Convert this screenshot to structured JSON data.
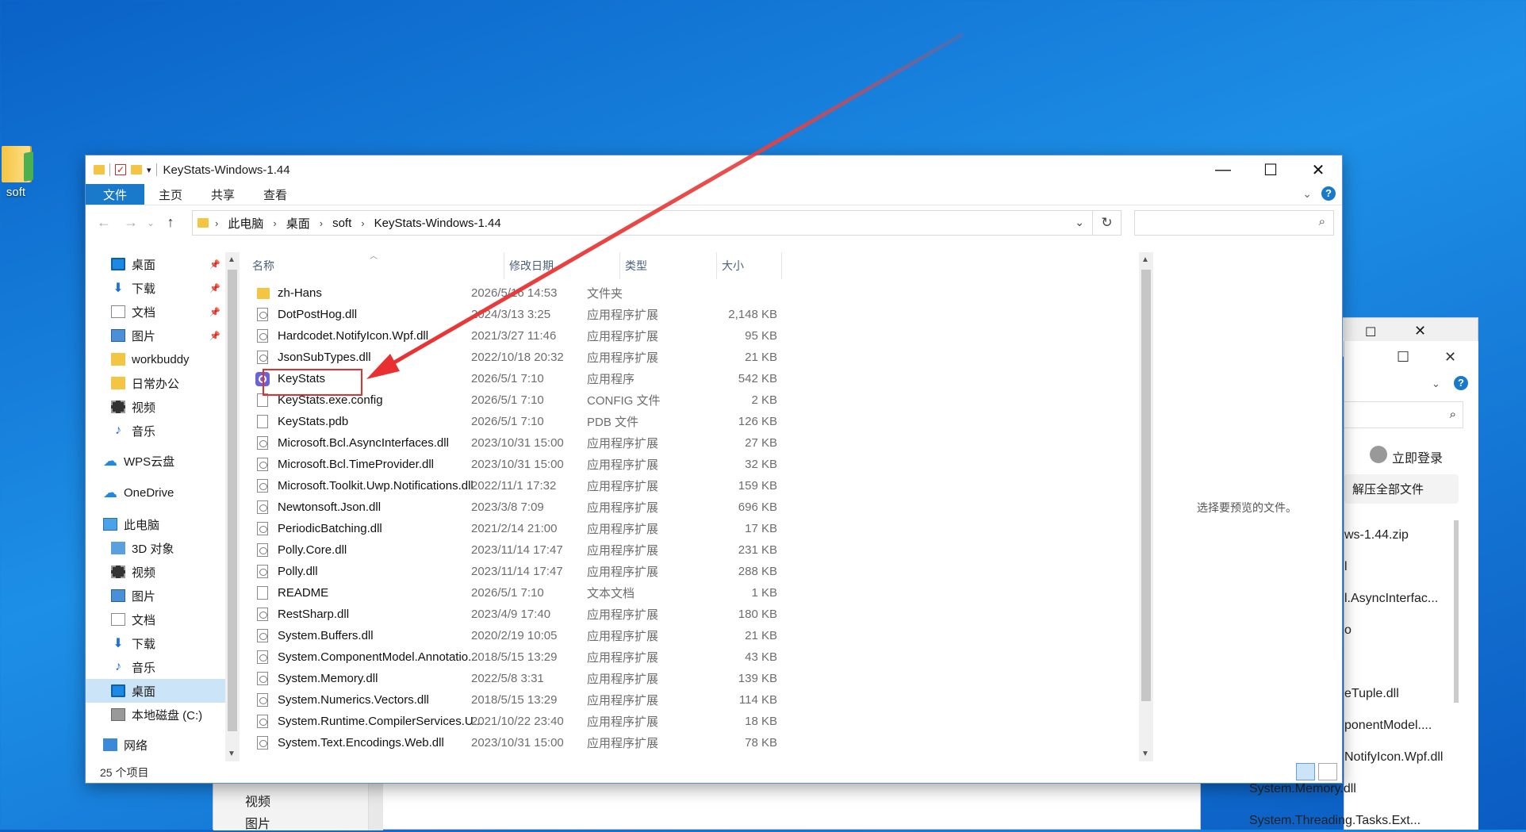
{
  "desktop": {
    "icon_label": "soft",
    "bg_window": {
      "items": [
        "立即登录",
        "解压全部文件",
        "ws-1.44.zip",
        "l",
        "l.AsyncInterfac...",
        "o",
        "eTuple.dll",
        "ponentModel....",
        "NotifyIcon.Wpf.dll",
        "System.Memory.dll",
        "System.Threading.Tasks.Ext..."
      ],
      "nav_items": [
        "视频",
        "图片"
      ]
    }
  },
  "window": {
    "title": "KeyStats-Windows-1.44",
    "controls": {
      "minimize": "—",
      "maximize": "☐",
      "close": "✕"
    },
    "ribbon": {
      "file": "文件",
      "home": "主页",
      "share": "共享",
      "view": "查看"
    },
    "address": {
      "crumbs": [
        "此电脑",
        "桌面",
        "soft",
        "KeyStats-Windows-1.44"
      ]
    },
    "search_placeholder": "",
    "nav": [
      {
        "label": "桌面",
        "icon": "desktop-icon",
        "pinned": true
      },
      {
        "label": "下载",
        "icon": "download-icon",
        "pinned": true
      },
      {
        "label": "文档",
        "icon": "document-icon",
        "pinned": true
      },
      {
        "label": "图片",
        "icon": "picture-icon",
        "pinned": true
      },
      {
        "label": "workbuddy",
        "icon": "folder-icon",
        "pinned": false
      },
      {
        "label": "日常办公",
        "icon": "folder-icon",
        "pinned": false
      },
      {
        "label": "视频",
        "icon": "video-icon",
        "pinned": false
      },
      {
        "label": "音乐",
        "icon": "music-icon",
        "pinned": false
      },
      {
        "label": "WPS云盘",
        "icon": "cloud-icon",
        "pinned": false
      },
      {
        "label": "OneDrive",
        "icon": "cloud-icon",
        "pinned": false
      },
      {
        "label": "此电脑",
        "icon": "pc-icon",
        "pinned": false
      },
      {
        "label": "3D 对象",
        "icon": "3d-icon",
        "pinned": false
      },
      {
        "label": "视频",
        "icon": "video-icon",
        "pinned": false
      },
      {
        "label": "图片",
        "icon": "picture-icon",
        "pinned": false
      },
      {
        "label": "文档",
        "icon": "document-icon",
        "pinned": false
      },
      {
        "label": "下载",
        "icon": "download-icon",
        "pinned": false
      },
      {
        "label": "音乐",
        "icon": "music-icon",
        "pinned": false
      },
      {
        "label": "桌面",
        "icon": "desktop-icon",
        "pinned": false,
        "selected": true
      },
      {
        "label": "本地磁盘 (C:)",
        "icon": "disk-icon",
        "pinned": false
      },
      {
        "label": "网络",
        "icon": "network-icon",
        "pinned": false
      }
    ],
    "columns": {
      "name": "名称",
      "date": "修改日期",
      "type": "类型",
      "size": "大小"
    },
    "files": [
      {
        "name": "zh-Hans",
        "date": "2026/5/16 14:53",
        "type": "文件夹",
        "size": "",
        "icon": "folder"
      },
      {
        "name": "DotPostHog.dll",
        "date": "2024/3/13 3:25",
        "type": "应用程序扩展",
        "size": "2,148 KB",
        "icon": "gear"
      },
      {
        "name": "Hardcodet.NotifyIcon.Wpf.dll",
        "date": "2021/3/27 11:46",
        "type": "应用程序扩展",
        "size": "95 KB",
        "icon": "gear"
      },
      {
        "name": "JsonSubTypes.dll",
        "date": "2022/10/18 20:32",
        "type": "应用程序扩展",
        "size": "21 KB",
        "icon": "gear"
      },
      {
        "name": "KeyStats",
        "date": "2026/5/1 7:10",
        "type": "应用程序",
        "size": "542 KB",
        "icon": "app"
      },
      {
        "name": "KeyStats.exe.config",
        "date": "2026/5/1 7:10",
        "type": "CONFIG 文件",
        "size": "2 KB",
        "icon": "file"
      },
      {
        "name": "KeyStats.pdb",
        "date": "2026/5/1 7:10",
        "type": "PDB 文件",
        "size": "126 KB",
        "icon": "file"
      },
      {
        "name": "Microsoft.Bcl.AsyncInterfaces.dll",
        "date": "2023/10/31 15:00",
        "type": "应用程序扩展",
        "size": "27 KB",
        "icon": "gear"
      },
      {
        "name": "Microsoft.Bcl.TimeProvider.dll",
        "date": "2023/10/31 15:00",
        "type": "应用程序扩展",
        "size": "32 KB",
        "icon": "gear"
      },
      {
        "name": "Microsoft.Toolkit.Uwp.Notifications.dll",
        "date": "2022/11/1 17:32",
        "type": "应用程序扩展",
        "size": "159 KB",
        "icon": "gear"
      },
      {
        "name": "Newtonsoft.Json.dll",
        "date": "2023/3/8 7:09",
        "type": "应用程序扩展",
        "size": "696 KB",
        "icon": "gear"
      },
      {
        "name": "PeriodicBatching.dll",
        "date": "2021/2/14 21:00",
        "type": "应用程序扩展",
        "size": "17 KB",
        "icon": "gear"
      },
      {
        "name": "Polly.Core.dll",
        "date": "2023/11/14 17:47",
        "type": "应用程序扩展",
        "size": "231 KB",
        "icon": "gear"
      },
      {
        "name": "Polly.dll",
        "date": "2023/11/14 17:47",
        "type": "应用程序扩展",
        "size": "288 KB",
        "icon": "gear"
      },
      {
        "name": "README",
        "date": "2026/5/1 7:10",
        "type": "文本文档",
        "size": "1 KB",
        "icon": "file"
      },
      {
        "name": "RestSharp.dll",
        "date": "2023/4/9 17:40",
        "type": "应用程序扩展",
        "size": "180 KB",
        "icon": "gear"
      },
      {
        "name": "System.Buffers.dll",
        "date": "2020/2/19 10:05",
        "type": "应用程序扩展",
        "size": "21 KB",
        "icon": "gear"
      },
      {
        "name": "System.ComponentModel.Annotatio...",
        "date": "2018/5/15 13:29",
        "type": "应用程序扩展",
        "size": "43 KB",
        "icon": "gear"
      },
      {
        "name": "System.Memory.dll",
        "date": "2022/5/8 3:31",
        "type": "应用程序扩展",
        "size": "139 KB",
        "icon": "gear"
      },
      {
        "name": "System.Numerics.Vectors.dll",
        "date": "2018/5/15 13:29",
        "type": "应用程序扩展",
        "size": "114 KB",
        "icon": "gear"
      },
      {
        "name": "System.Runtime.CompilerServices.U...",
        "date": "2021/10/22 23:40",
        "type": "应用程序扩展",
        "size": "18 KB",
        "icon": "gear"
      },
      {
        "name": "System.Text.Encodings.Web.dll",
        "date": "2023/10/31 15:00",
        "type": "应用程序扩展",
        "size": "78 KB",
        "icon": "gear"
      }
    ],
    "preview_message": "选择要预览的文件。",
    "status": "25 个项目"
  },
  "colors": {
    "accent": "#1979ca",
    "annotation": "#e03030",
    "selection": "#cce4f7"
  }
}
